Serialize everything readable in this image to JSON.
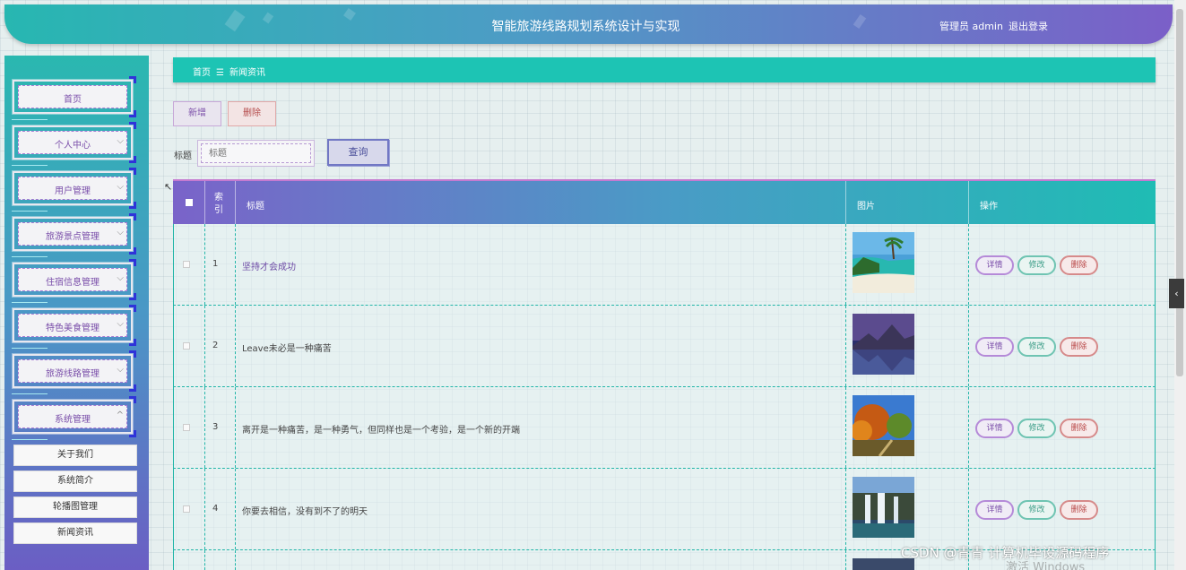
{
  "header": {
    "title": "智能旅游线路规划系统设计与实现",
    "user": "管理员 admin",
    "logout": "退出登录"
  },
  "sidebar": {
    "items": [
      {
        "label": "首页",
        "expandable": false
      },
      {
        "label": "个人中心",
        "expandable": true
      },
      {
        "label": "用户管理",
        "expandable": true
      },
      {
        "label": "旅游景点管理",
        "expandable": true
      },
      {
        "label": "住宿信息管理",
        "expandable": true
      },
      {
        "label": "特色美食管理",
        "expandable": true
      },
      {
        "label": "旅游线路管理",
        "expandable": true
      },
      {
        "label": "系统管理",
        "expandable": true,
        "expanded": true
      }
    ],
    "subitems": [
      "关于我们",
      "系统简介",
      "轮播图管理",
      "新闻资讯"
    ],
    "chevron_down": "⌵",
    "chevron_up": "^"
  },
  "breadcrumb": {
    "home": "首页",
    "separator": "☰",
    "current": "新闻资讯"
  },
  "toolbar": {
    "add_label": "新增",
    "delete_label": "删除"
  },
  "search": {
    "label": "标题",
    "placeholder": "标题",
    "button": "查询"
  },
  "table": {
    "headers": {
      "index": "索引",
      "title": "标题",
      "image": "图片",
      "ops": "操作"
    },
    "rows": [
      {
        "index": "1",
        "title": "坚持才会成功",
        "image": "beach-scene"
      },
      {
        "index": "2",
        "title": "Leave未必是一种痛苦",
        "image": "mountain-lake-night"
      },
      {
        "index": "3",
        "title": "离开是一种痛苦，是一种勇气，但同样也是一个考验，是一个新的开端",
        "image": "autumn-trees"
      },
      {
        "index": "4",
        "title": "你要去相信，没有到不了的明天",
        "image": "waterfall"
      }
    ],
    "ops": {
      "detail": "详情",
      "edit": "修改",
      "delete": "删除"
    }
  },
  "overlay": {
    "watermark": "CSDN @青青  计算机毕设源码程序",
    "activate": "激活 Windows",
    "handle": "‹"
  }
}
